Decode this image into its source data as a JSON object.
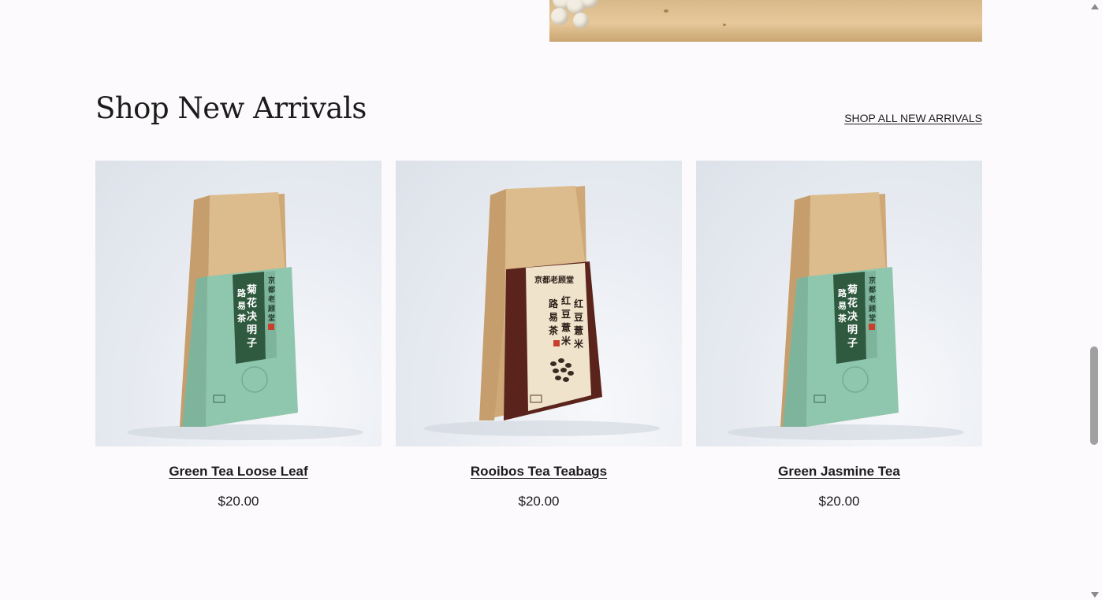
{
  "section": {
    "title": "Shop New Arrivals",
    "shop_all_label": "SHOP ALL NEW ARRIVALS"
  },
  "products": [
    {
      "name": "Green Tea Loose Leaf",
      "price": "$20.00",
      "package": "green-tea-bag-image"
    },
    {
      "name": "Rooibos Tea Teabags",
      "price": "$20.00",
      "package": "rooibos-tea-bag-image"
    },
    {
      "name": "Green Jasmine Tea",
      "price": "$20.00",
      "package": "green-tea-bag-image"
    }
  ],
  "colors": {
    "background": "#fcfafc",
    "text": "#1c1c1c",
    "kraft": "#d9b98c",
    "green_label": "#8fc6ae",
    "dark_green_band": "#2f5a3f",
    "rooibos_band": "#5a241c"
  }
}
